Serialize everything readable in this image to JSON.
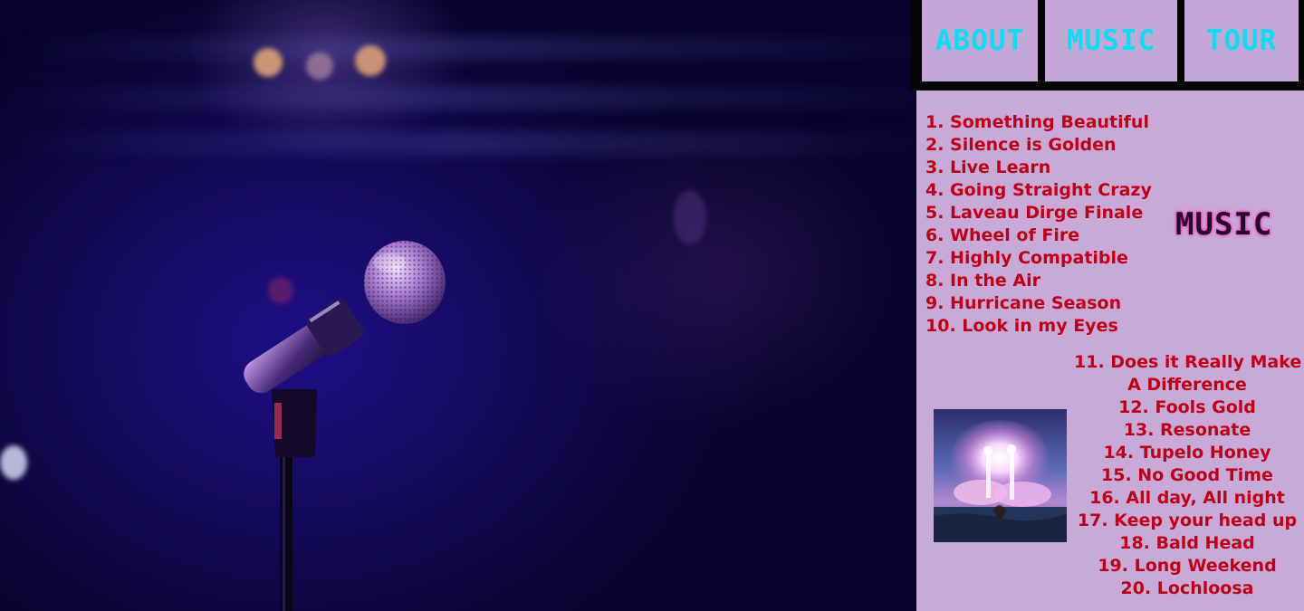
{
  "nav": {
    "tabs": [
      {
        "label": "ABOUT"
      },
      {
        "label": "MUSIC"
      },
      {
        "label": "TOUR"
      }
    ]
  },
  "music": {
    "heading": "MUSIC",
    "tracks_primary": [
      "1. Something Beautiful",
      "2. Silence is Golden",
      "3. Live Learn",
      "4. Going Straight Crazy",
      "5. Laveau Dirge Finale",
      "6. Wheel of Fire",
      "7. Highly Compatible",
      "8. In the Air",
      "9. Hurricane Season",
      "10. Look in my Eyes"
    ],
    "tracks_secondary": [
      "11. Does it Really Make",
      "A Difference",
      "12. Fools Gold",
      "13. Resonate",
      "14. Tupelo Honey",
      "15. No Good Time",
      "16. All day, All night",
      "17. Keep your head up",
      "18. Bald Head",
      "19. Long Weekend",
      "20. Lochloosa"
    ]
  },
  "colors": {
    "panel_background": "#c8aad8",
    "nav_text": "#08dff0",
    "track_text": "#c00019",
    "heading_glow": "#ff2fb8"
  }
}
